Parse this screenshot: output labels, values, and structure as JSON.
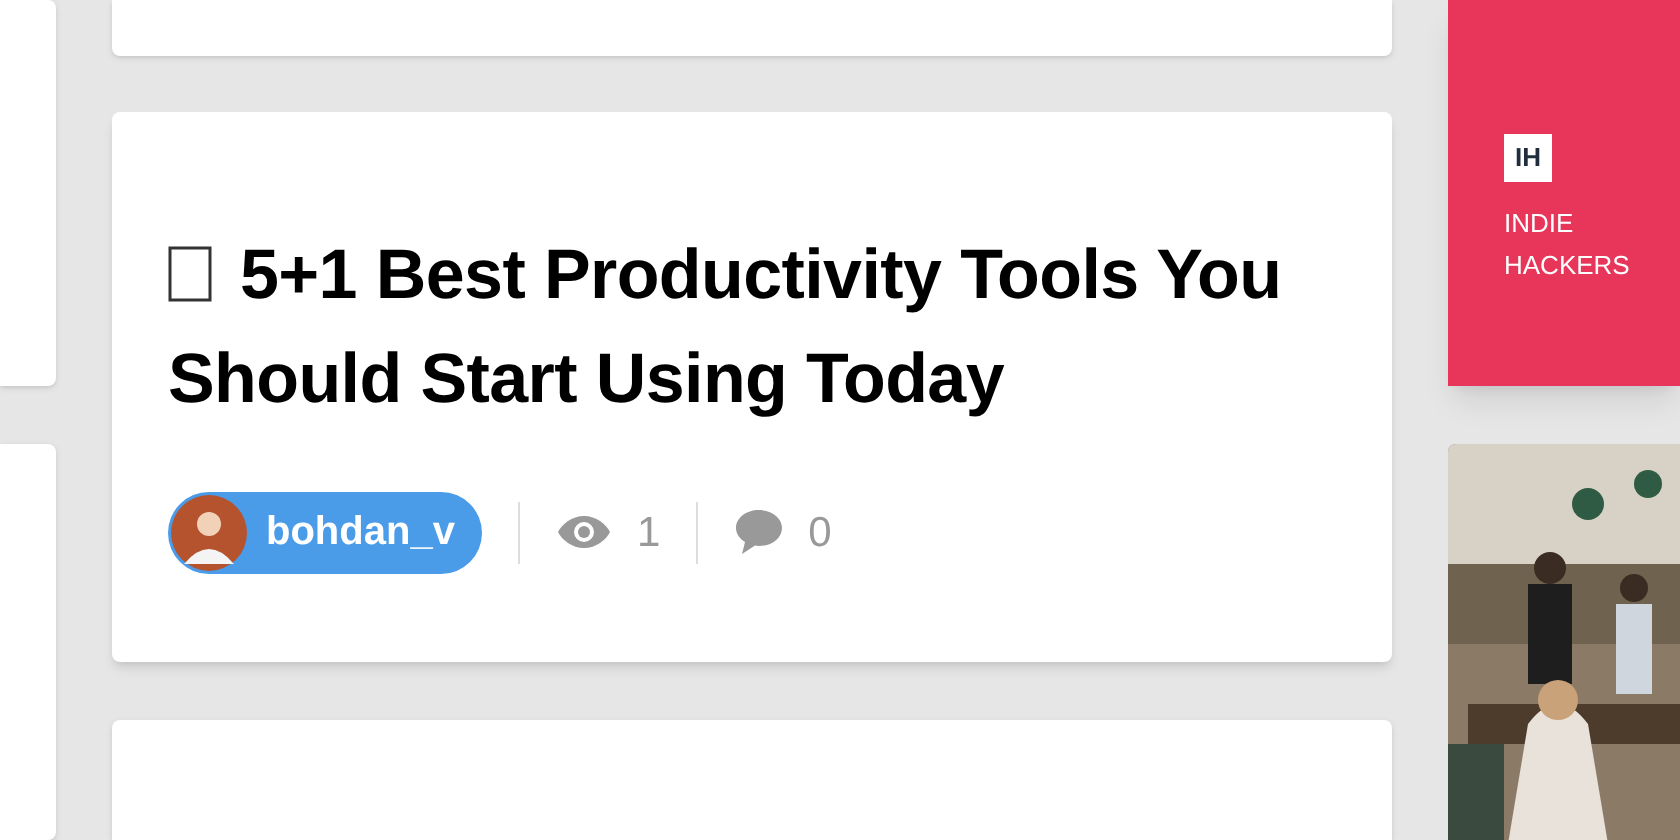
{
  "post": {
    "title": "5+1 Best Productivity Tools You Should Start Using Today",
    "author": {
      "name": "bohdan_v"
    },
    "stats": [
      {
        "kind": "views",
        "count": "1"
      },
      {
        "kind": "comments",
        "count": "0"
      }
    ]
  },
  "sponsor": {
    "logo": "IH",
    "name": "INDIE HACKERS"
  }
}
